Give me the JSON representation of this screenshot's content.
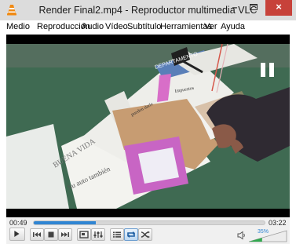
{
  "window": {
    "title": "Render Final2.mp4 - Reproductor multimedia VLC",
    "minimize": "–",
    "close": "×"
  },
  "menu": [
    "Medio",
    "Reproducción",
    "Audio",
    "Vídeo",
    "Subtítulo",
    "Herramientas",
    "Ver",
    "Ayuda"
  ],
  "video": {
    "newspaper_texts": [
      "BUENA VIDA",
      "Su auto también",
      "DEPARTAMENTO",
      "pueden darle",
      "Impuestos"
    ]
  },
  "controls": {
    "current_time": "00:49",
    "total_time": "03:22",
    "progress_fraction": 0.27,
    "volume_label": "35%",
    "volume_fraction": 0.35
  },
  "colors": {
    "accent": "#2f85d3",
    "close_button": "#c7423a",
    "vlc_orange": "#f08a14"
  },
  "icons": [
    "vlc-cone-icon",
    "pause-icon",
    "play-icon",
    "previous-icon",
    "stop-icon",
    "next-icon",
    "fullscreen-icon",
    "extended-settings-icon",
    "playlist-icon",
    "loop-icon",
    "shuffle-icon",
    "speaker-icon"
  ]
}
